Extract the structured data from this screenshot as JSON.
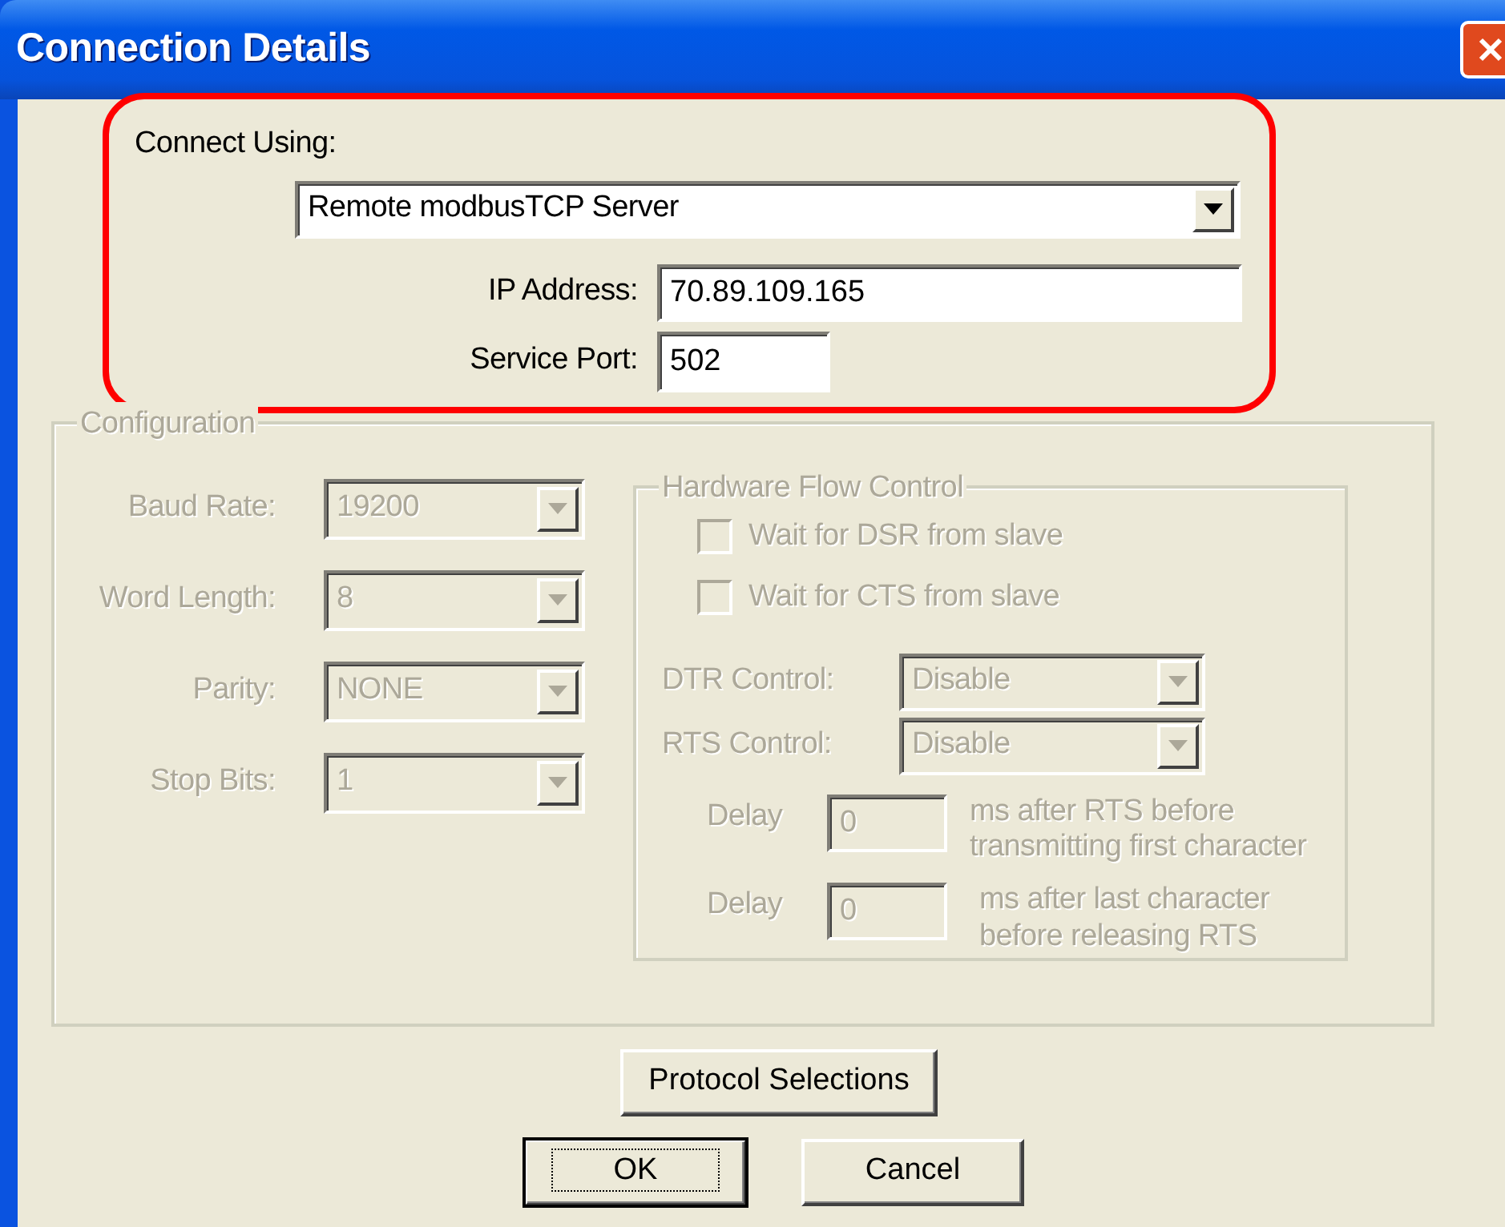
{
  "window": {
    "title": "Connection Details"
  },
  "connection": {
    "highlighted": true,
    "connect_using_label": "Connect Using:",
    "connect_using": {
      "value": "Remote modbusTCP Server"
    },
    "fields": [
      {
        "label": "IP Address:",
        "value": "70.89.109.165"
      },
      {
        "label": "Service Port:",
        "value": "502"
      }
    ]
  },
  "configuration": {
    "title": "Configuration",
    "disabled": true,
    "settings": [
      {
        "label": "Baud Rate:",
        "value": "19200"
      },
      {
        "label": "Word Length:",
        "value": "8"
      },
      {
        "label": "Parity:",
        "value": "NONE"
      },
      {
        "label": "Stop Bits:",
        "value": "1"
      }
    ]
  },
  "hardware_flow_control": {
    "title": "Hardware Flow Control",
    "disabled": true,
    "checkboxes": [
      {
        "label": "Wait for DSR from slave",
        "checked": false
      },
      {
        "label": "Wait for CTS from slave",
        "checked": false
      }
    ],
    "controls": [
      {
        "label": "DTR Control:",
        "value": "Disable"
      },
      {
        "label": "RTS Control:",
        "value": "Disable"
      }
    ],
    "delays": [
      {
        "label": "Delay",
        "value": "0",
        "note_lines": [
          "ms after RTS before",
          "transmitting first character"
        ]
      },
      {
        "label": "Delay",
        "value": "0",
        "note_lines": [
          "ms after last character",
          "before releasing RTS"
        ]
      }
    ]
  },
  "buttons": [
    {
      "label": "Protocol Selections",
      "default": false
    },
    {
      "label": "OK",
      "default": true
    },
    {
      "label": "Cancel",
      "default": false
    }
  ]
}
